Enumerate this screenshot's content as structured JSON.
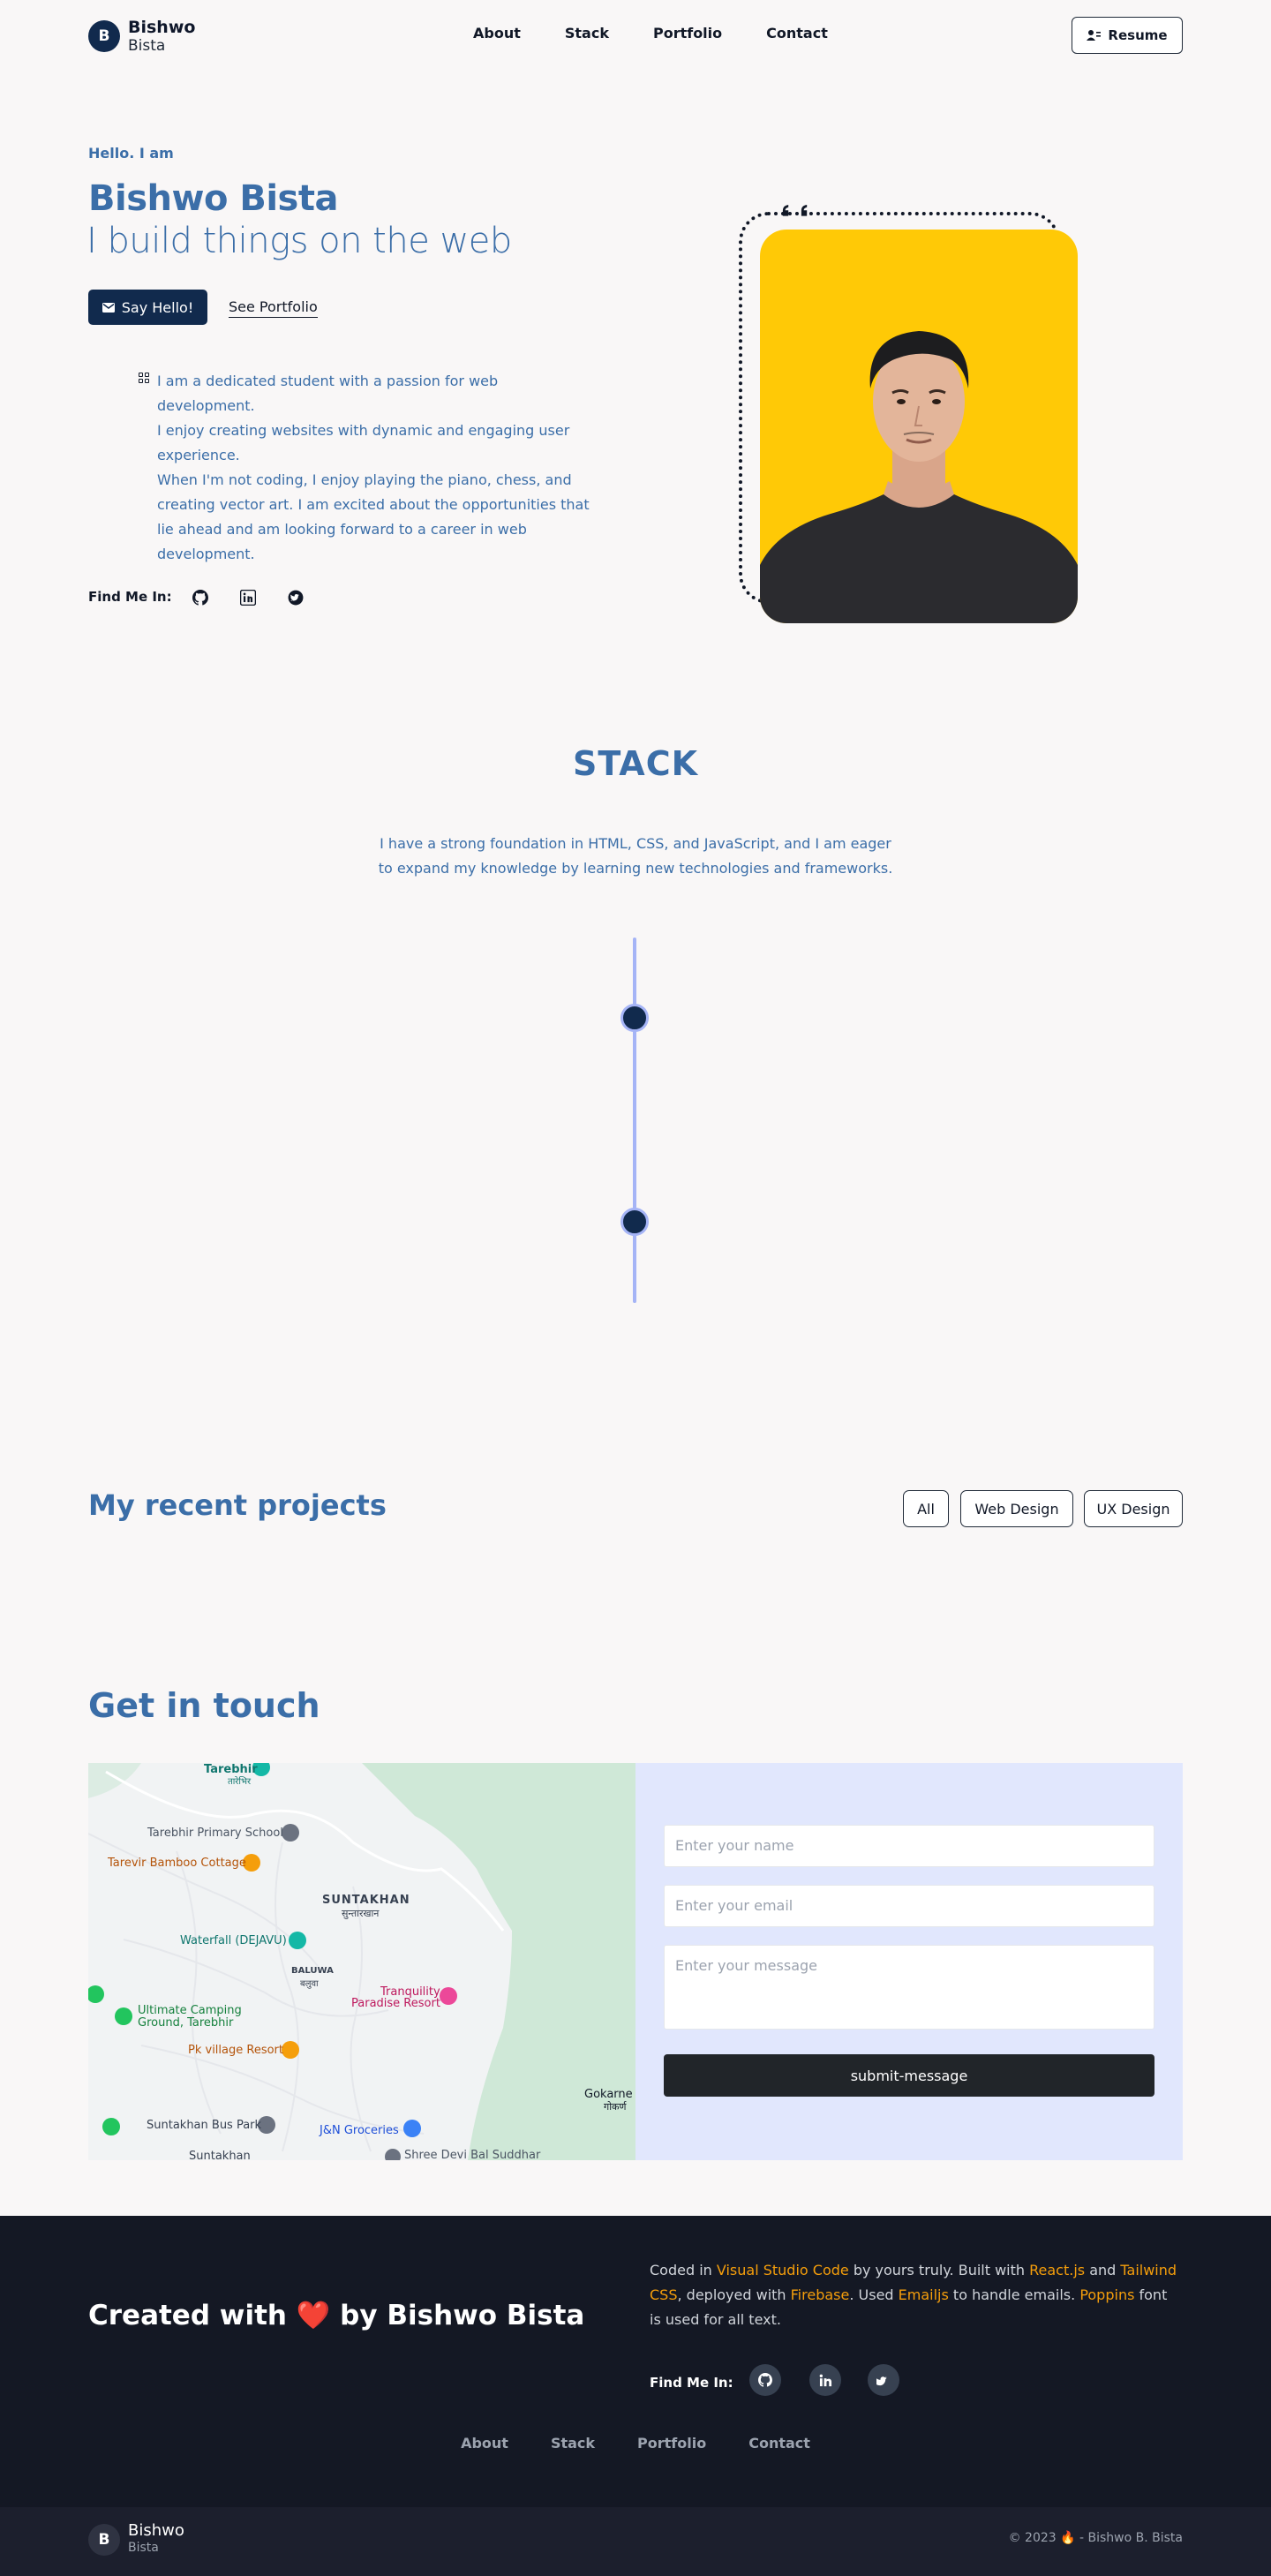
{
  "brand": {
    "initial": "B",
    "first": "Bishwo",
    "last": "Bista"
  },
  "nav": {
    "links": [
      "About",
      "Stack",
      "Portfolio",
      "Contact"
    ],
    "resume_label": "Resume"
  },
  "hero": {
    "greeting": "Hello. I am",
    "name": "Bishwo Bista",
    "tagline": "I build things on the web",
    "say_hello": "Say Hello!",
    "see_portfolio": "See Portfolio",
    "bio": "I am a dedicated student with a passion for web development.\nI enjoy creating websites with dynamic and engaging user\nexperience.\nWhen I'm not coding, I enjoy playing the piano, chess, and\ncreating vector art. I am excited about the opportunities that\nlie ahead and am looking forward to a career in web\ndevelopment.",
    "find_me": "Find Me In:"
  },
  "stack": {
    "title": "STACK",
    "description": "I have a strong foundation in HTML, CSS, and JavaScript, and I am eager\nto expand my knowledge by learning new technologies and frameworks."
  },
  "projects": {
    "title": "My recent projects",
    "filters": [
      "All",
      "Web Design",
      "UX Design"
    ]
  },
  "contact": {
    "title": "Get in touch",
    "name_placeholder": "Enter your name",
    "email_placeholder": "Enter your email",
    "message_placeholder": "Enter your message",
    "submit": "submit-message",
    "map_labels": {
      "tarebhir": "Tarebhir",
      "tarebhir_np": "तारेभिर",
      "school": "Tarebhir Primary School",
      "bamboo": "Tarevir Bamboo Cottage",
      "suntakhan": "SUNTAKHAN",
      "suntakhan_np": "सुन्तारखान",
      "waterfall": "Waterfall (DEJAVU)",
      "baluwa": "BALUWA",
      "baluwa_np": "बलुवा",
      "tranquility1": "Tranquility",
      "tranquility2": "Paradise Resort",
      "camping1": "Ultimate Camping",
      "camping2": "Ground, Tarebhir",
      "pk": "Pk village Resort",
      "gokarne": "Gokarne",
      "gokarne_np": "गोकर्ण",
      "bus": "Suntakhan Bus Park",
      "jn": "J&N Groceries",
      "shree": "Shree Devi Bal Suddhar",
      "suntakhan2": "Suntakhan"
    }
  },
  "footer": {
    "created_prefix": "Created with",
    "created_heart": "❤️",
    "created_suffix": "by Bishwo Bista",
    "about_parts": {
      "p1": "Coded in ",
      "vscode": "Visual Studio Code",
      "p2": " by yours truly. Built with ",
      "react": "React.js",
      "p3": " and ",
      "tailwind": "Tailwind CSS",
      "p4": ", deployed with ",
      "firebase": "Firebase",
      "p5": ". Used ",
      "emailjs": "Emailjs",
      "p6": " to handle emails. ",
      "poppins": "Poppins",
      "p7": " font is used for all text."
    },
    "find_me": "Find Me In:",
    "links": [
      "About",
      "Stack",
      "Portfolio",
      "Contact"
    ],
    "copyright": "© 2023 🔥 - Bishwo B. Bista"
  },
  "colors": {
    "accent": "#3b6ea8",
    "navy": "#112a4d",
    "photo_bg": "#ffc906",
    "highlight": "#f59e0b"
  },
  "icons": [
    "github-icon",
    "linkedin-icon",
    "twitter-icon",
    "mail-icon",
    "user-icon"
  ]
}
